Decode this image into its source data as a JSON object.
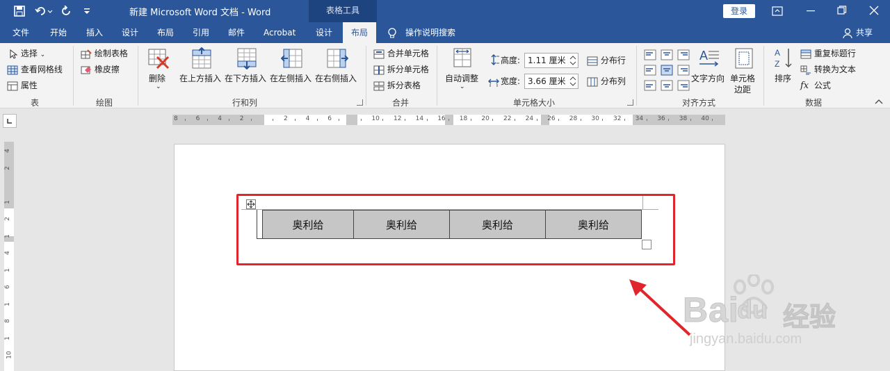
{
  "titlebar": {
    "doc_title": "新建 Microsoft Word 文档  -  Word",
    "context_tab": "表格工具",
    "signin": "登录"
  },
  "tabs": [
    "文件",
    "开始",
    "插入",
    "设计",
    "布局",
    "引用",
    "邮件",
    "Acrobat",
    "设计",
    "布局"
  ],
  "tellme": "操作说明搜索",
  "share": "共享",
  "groups": {
    "table": {
      "label": "表",
      "select": "选择",
      "gridlines": "查看网格线",
      "properties": "属性"
    },
    "draw": {
      "label": "绘图",
      "draw_table": "绘制表格",
      "eraser": "橡皮擦"
    },
    "rowscols": {
      "label": "行和列",
      "delete": "删除",
      "insert_above": "在上方插入",
      "insert_below": "在下方插入",
      "insert_left": "在左侧插入",
      "insert_right": "在右侧插入"
    },
    "merge": {
      "label": "合并",
      "merge_cells": "合并单元格",
      "split_cells": "拆分单元格",
      "split_table": "拆分表格"
    },
    "cellsize": {
      "label": "单元格大小",
      "autofit": "自动调整",
      "height_label": "高度:",
      "height_value": "1.11 厘米",
      "width_label": "宽度:",
      "width_value": "3.66 厘米",
      "dist_rows": "分布行",
      "dist_cols": "分布列"
    },
    "alignment": {
      "label": "对齐方式",
      "text_direction": "文字方向",
      "cell_margins_1": "单元格",
      "cell_margins_2": "边距"
    },
    "data": {
      "label": "数据",
      "sort": "排序",
      "repeat_header": "重复标题行",
      "convert": "转换为文本",
      "formula": "公式"
    }
  },
  "ruler": {
    "h_ticks": [
      "8",
      "6",
      "4",
      "2",
      "",
      "2",
      "4",
      "6",
      "",
      "10",
      "12",
      "14",
      "16",
      "18",
      "20",
      "22",
      "24",
      "26",
      "28",
      "30",
      "32",
      "34",
      "36",
      "38",
      "40"
    ],
    "v_ticks": [
      "4",
      "2",
      "",
      "1",
      "2",
      "1",
      "4",
      "1",
      "6",
      "1",
      "8",
      "1",
      "10"
    ]
  },
  "table": {
    "cells": [
      "奥利给",
      "奥利给",
      "奥利给",
      "奥利给"
    ]
  },
  "watermark": {
    "text1": "Bai",
    "text2": "du",
    "text3": "经验",
    "url": "jingyan.baidu.com"
  },
  "colors": {
    "accent": "#2b579a",
    "highlight": "#e0262c",
    "cell_fill": "#c6c6c6"
  }
}
